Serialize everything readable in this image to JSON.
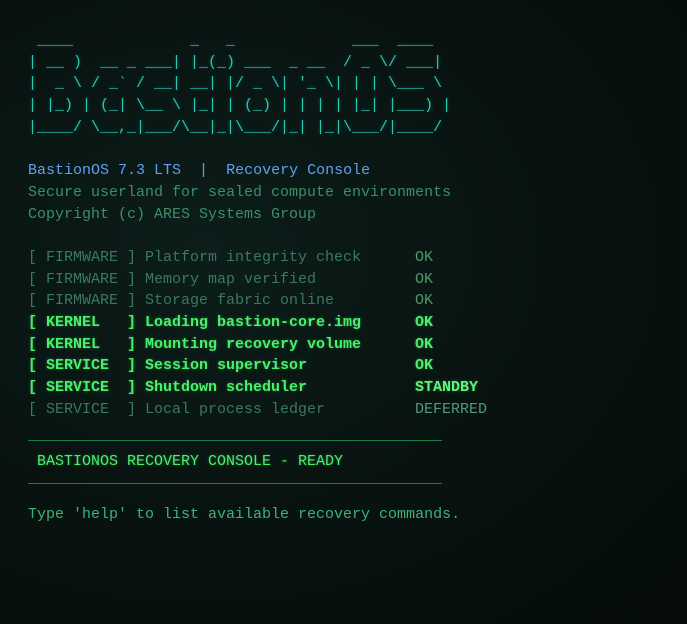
{
  "ascii_logo": [
    " ____             _   _             ___  ____  ",
    "| __ )  __ _ ___| |_(_) ___  _ __  / _ \\/ ___| ",
    "|  _ \\ / _` / __| __| |/ _ \\| '_ \\| | | \\___ \\ ",
    "| |_) | (_| \\__ \\ |_| | (_) | | | | |_| |___) |",
    "|____/ \\__,_|___/\\__|_|\\___/|_| |_|\\___/|____/ "
  ],
  "header": {
    "product": "BastionOS 7.3 LTS",
    "separator": "|",
    "console_name": "Recovery Console",
    "tagline": "Secure userland for sealed compute environments",
    "copyright": "Copyright (c) ARES Systems Group"
  },
  "boot_log": [
    {
      "tag": "[ FIRMWARE ]",
      "message": "Platform integrity check",
      "status": "OK",
      "state": "dim"
    },
    {
      "tag": "[ FIRMWARE ]",
      "message": "Memory map verified",
      "status": "OK",
      "state": "dim"
    },
    {
      "tag": "[ FIRMWARE ]",
      "message": "Storage fabric online",
      "status": "OK",
      "state": "dim"
    },
    {
      "tag": "[ KERNEL   ]",
      "message": "Loading bastion-core.img",
      "status": "OK",
      "state": "active"
    },
    {
      "tag": "[ KERNEL   ]",
      "message": "Mounting recovery volume",
      "status": "OK",
      "state": "active"
    },
    {
      "tag": "[ SERVICE  ]",
      "message": "Session supervisor",
      "status": "OK",
      "state": "active"
    },
    {
      "tag": "[ SERVICE  ]",
      "message": "Shutdown scheduler",
      "status": "STANDBY",
      "state": "active"
    },
    {
      "tag": "[ SERVICE  ]",
      "message": "Local process ledger",
      "status": "DEFERRED",
      "state": "dim"
    }
  ],
  "banner": "BASTIONOS RECOVERY CONSOLE - READY",
  "prompt_hint": "Type 'help' to list available recovery commands."
}
